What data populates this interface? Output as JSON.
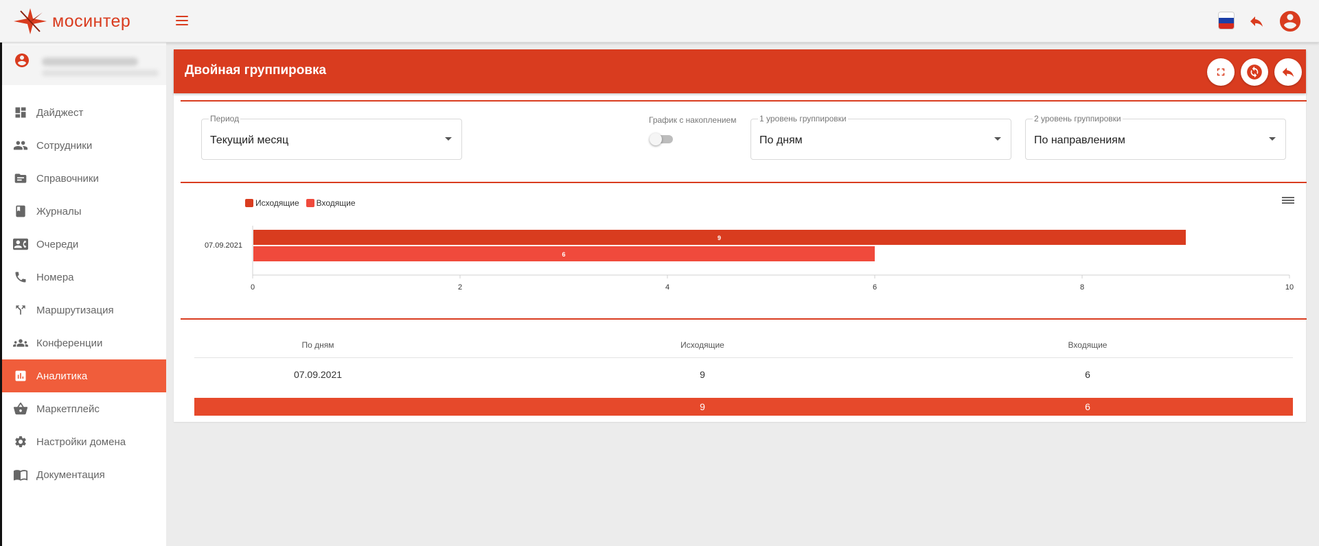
{
  "brand": {
    "name": "мосинтер"
  },
  "sidebar": {
    "user": {
      "name": "",
      "email": ""
    },
    "items": [
      {
        "label": "Дайджест",
        "icon": "dashboard-icon"
      },
      {
        "label": "Сотрудники",
        "icon": "people-icon"
      },
      {
        "label": "Справочники",
        "icon": "folder-icon"
      },
      {
        "label": "Журналы",
        "icon": "book-icon"
      },
      {
        "label": "Очереди",
        "icon": "contact-card-icon"
      },
      {
        "label": "Номера",
        "icon": "phone-icon"
      },
      {
        "label": "Маршрутизация",
        "icon": "routing-icon"
      },
      {
        "label": "Конференции",
        "icon": "groups-icon"
      },
      {
        "label": "Аналитика",
        "icon": "analytics-icon",
        "active": true
      },
      {
        "label": "Маркетплейс",
        "icon": "basket-icon"
      },
      {
        "label": "Настройки домена",
        "icon": "gear-icon"
      },
      {
        "label": "Документация",
        "icon": "docs-icon"
      }
    ]
  },
  "card": {
    "title": "Двойная группировка"
  },
  "filters": {
    "period": {
      "label": "Период",
      "value": "Текущий месяц"
    },
    "accumulate": {
      "label": "График с накоплением",
      "checked": false
    },
    "level1": {
      "label": "1 уровень группировки",
      "value": "По дням"
    },
    "level2": {
      "label": "2 уровень группировки",
      "value": "По направлениям"
    }
  },
  "colors": {
    "accent": "#d93c1f",
    "outgoing": "#d93c1f",
    "incoming": "#f04a3c",
    "total_row": "#e6492b"
  },
  "chart_data": {
    "type": "bar",
    "orientation": "horizontal",
    "categories": [
      "07.09.2021"
    ],
    "series": [
      {
        "name": "Исходящие",
        "values": [
          9
        ]
      },
      {
        "name": "Входящие",
        "values": [
          6
        ]
      }
    ],
    "xlim": [
      0,
      10
    ],
    "xticks": [
      0,
      2,
      4,
      6,
      8,
      10
    ],
    "legend": "top-left",
    "data_labels": true,
    "grid": false
  },
  "table": {
    "columns": [
      "По дням",
      "Исходящие",
      "Входящие"
    ],
    "rows": [
      {
        "day": "07.09.2021",
        "out": "9",
        "in": "6"
      }
    ],
    "total": {
      "day": "",
      "out": "9",
      "in": "6"
    }
  }
}
